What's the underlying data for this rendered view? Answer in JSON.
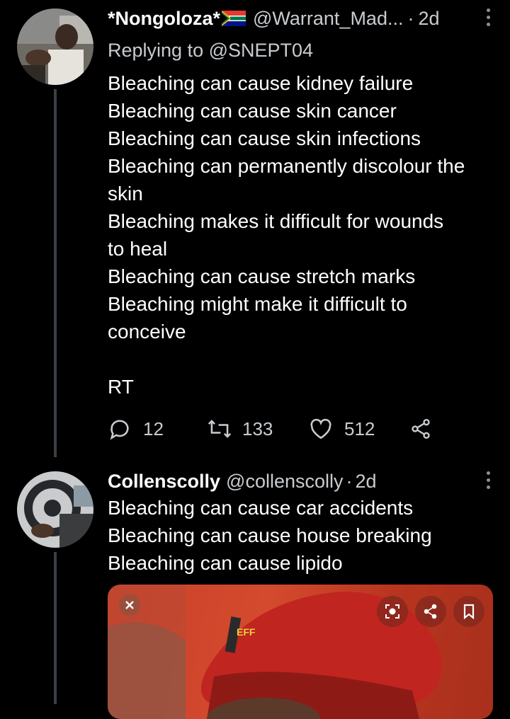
{
  "tweets": [
    {
      "name": "*Nongoloza*",
      "handle": "@Warrant_Mad...",
      "dot": "·",
      "time": "2d",
      "reply_to": "Replying to @SNEPT04",
      "lines": [
        "Bleaching can cause kidney failure",
        "Bleaching can cause skin cancer",
        "Bleaching can cause skin infections",
        "Bleaching can permanently discolour the",
        "skin",
        "Bleaching makes it difficult for wounds",
        "to heal",
        "Bleaching can cause stretch marks",
        "Bleaching might make it difficult to",
        "conceive",
        "",
        "RT"
      ],
      "actions": {
        "replies": "12",
        "retweets": "133",
        "likes": "512"
      },
      "icons": [
        "reply-icon",
        "retweet-icon",
        "like-icon",
        "share-icon",
        "more-icon"
      ]
    },
    {
      "name": "Collenscolly",
      "handle": "@collenscolly",
      "dot": "·",
      "time": "2d",
      "lines": [
        "Bleaching can cause car accidents",
        "Bleaching can cause house breaking",
        "Bleaching can cause lipido"
      ],
      "media": {
        "overlay_icons": [
          "close-icon",
          "lens-icon",
          "share-icon",
          "bookmark-icon"
        ],
        "beret_badge": "EFF"
      }
    }
  ],
  "colors": {
    "background": "#000000",
    "text": "#ffffff",
    "muted": "#c8ccd0",
    "thread_line": "#3a3f44",
    "beret_red": "#c0251f"
  }
}
